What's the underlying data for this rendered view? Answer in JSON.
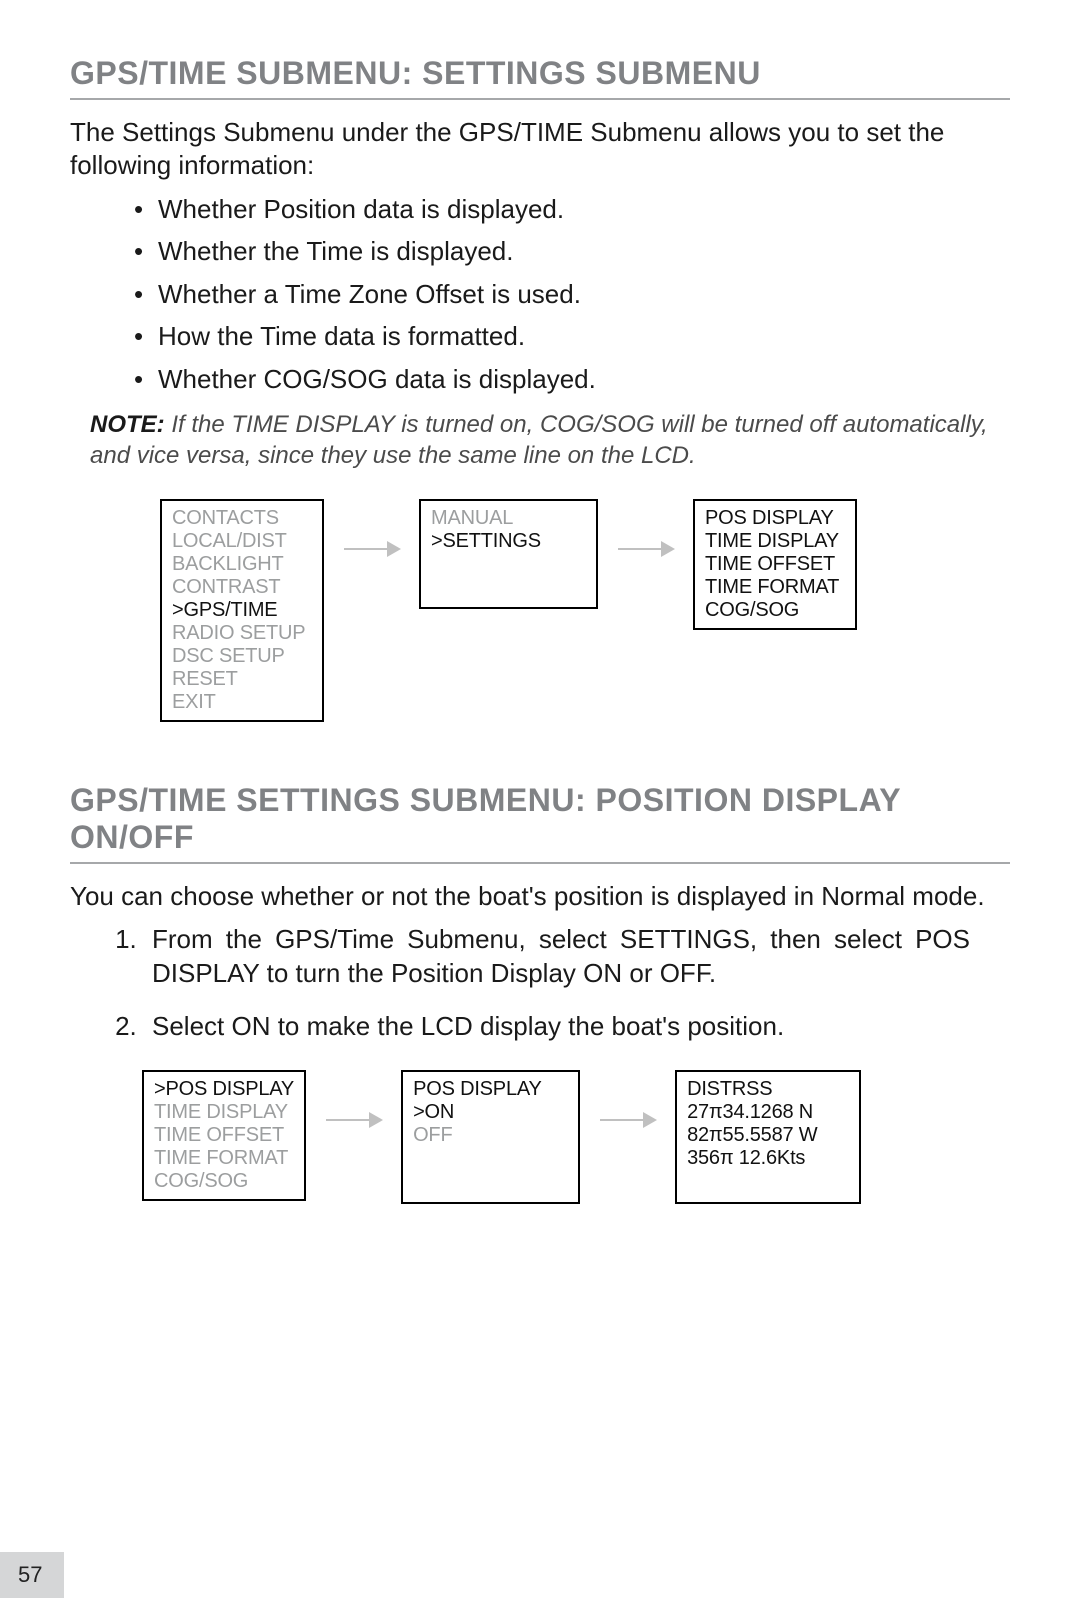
{
  "section1": {
    "title": "GPS/TIME SUBMENU: SETTINGS SUBMENU",
    "intro": "The Settings Submenu under the GPS/TIME Submenu allows you to set the following information:",
    "bullets": [
      "Whether Position data is displayed.",
      "Whether the Time is displayed.",
      "Whether a Time Zone Offset is used.",
      "How the Time data is formatted.",
      "Whether COG/SOG data is displayed."
    ],
    "note_label": "NOTE:",
    "note_text": " If the TIME DISPLAY is turned on, COG/SOG will be turned off automatically, and vice versa, since they use the same line on the LCD."
  },
  "flow1": {
    "box1": {
      "lines": [
        {
          "t": "CONTACTS",
          "dim": true
        },
        {
          "t": "LOCAL/DIST",
          "dim": true
        },
        {
          "t": "BACKLIGHT",
          "dim": true
        },
        {
          "t": "CONTRAST",
          "dim": true
        },
        {
          "t": ">GPS/TIME",
          "dim": false
        },
        {
          "t": "RADIO SETUP",
          "dim": true
        },
        {
          "t": "DSC SETUP",
          "dim": true
        },
        {
          "t": "RESET",
          "dim": true
        },
        {
          "t": "EXIT",
          "dim": true
        }
      ]
    },
    "box2": {
      "lines": [
        {
          "t": "MANUAL",
          "dim": true
        },
        {
          "t": ">SETTINGS",
          "dim": false
        }
      ],
      "minHeight": "94px",
      "minWidth": "155px"
    },
    "box3": {
      "lines": [
        {
          "t": "POS DISPLAY",
          "dim": false
        },
        {
          "t": "TIME DISPLAY",
          "dim": false
        },
        {
          "t": "TIME OFFSET",
          "dim": false
        },
        {
          "t": "TIME FORMAT",
          "dim": false
        },
        {
          "t": "COG/SOG",
          "dim": false
        }
      ]
    }
  },
  "section2": {
    "title": "GPS/TIME SETTINGS SUBMENU: POSITION DISPLAY ON/OFF",
    "intro": "You can choose whether or not the boat's position is displayed in Normal mode.",
    "steps": [
      "From the GPS/Time Submenu, select SETTINGS, then select POS DISPLAY to turn the Position Display ON or OFF.",
      "Select ON to make the LCD display the boat's position."
    ]
  },
  "flow2": {
    "box1": {
      "lines": [
        {
          "t": ">POS DISPLAY",
          "dim": false
        },
        {
          "t": "TIME DISPLAY",
          "dim": true
        },
        {
          "t": "TIME OFFSET",
          "dim": true
        },
        {
          "t": "TIME FORMAT",
          "dim": true
        },
        {
          "t": "COG/SOG",
          "dim": true
        }
      ]
    },
    "box2": {
      "lines": [
        {
          "t": " POS DISPLAY",
          "dim": false
        },
        {
          "t": ">ON",
          "dim": false
        },
        {
          "t": "OFF",
          "dim": true
        }
      ],
      "minHeight": "118px",
      "minWidth": "155px"
    },
    "box3": {
      "lines": [
        {
          "t": "DISTRSS",
          "dim": false
        },
        {
          "t": " 27π34.1268 N",
          "dim": false
        },
        {
          "t": " 82π55.5587 W",
          "dim": false
        },
        {
          "t": "356π  12.6Kts",
          "dim": false
        }
      ],
      "minHeight": "118px",
      "minWidth": "162px"
    }
  },
  "page_number": "57"
}
